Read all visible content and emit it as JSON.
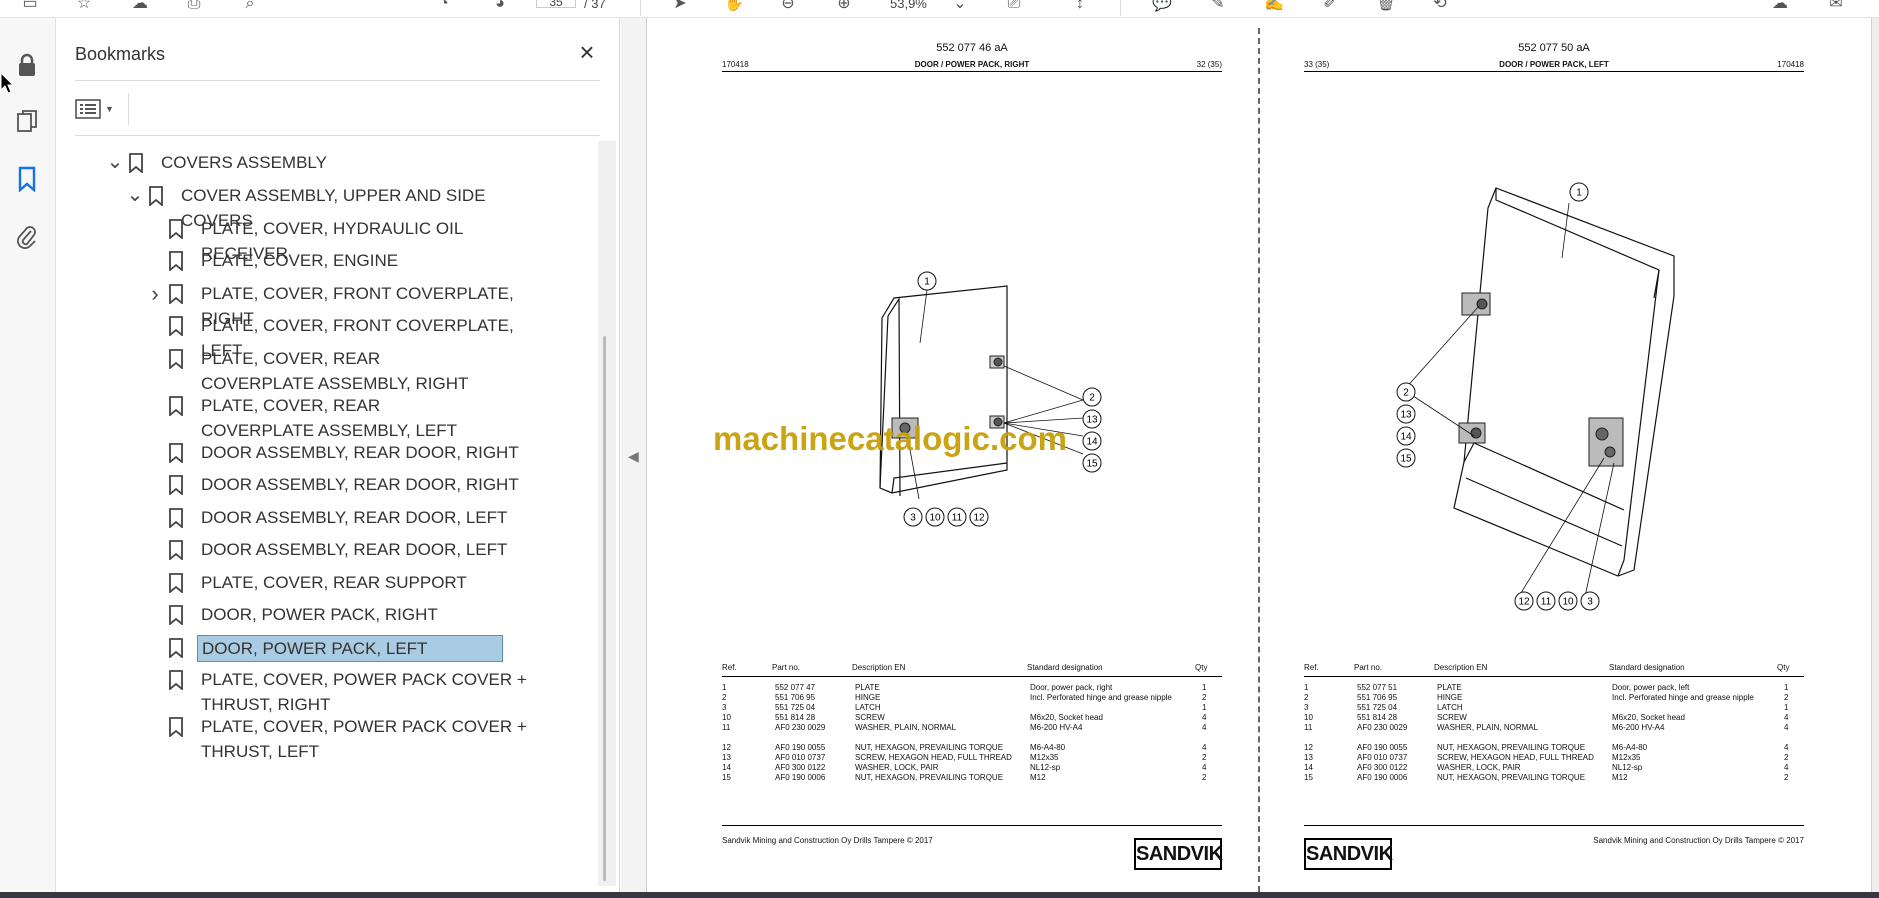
{
  "toolbar": {
    "page_current": "35",
    "page_total": "/ 37",
    "zoom": "53,9%"
  },
  "bookmarks_panel": {
    "title": "Bookmarks",
    "items": [
      {
        "label": "COVERS ASSEMBLY",
        "expanded": true
      },
      {
        "label": "COVER ASSEMBLY, UPPER AND SIDE COVERS",
        "expanded": true
      },
      {
        "label": "PLATE, COVER, HYDRAULIC OIL RECEIVER"
      },
      {
        "label": "PLATE, COVER, ENGINE"
      },
      {
        "label": "PLATE, COVER, FRONT COVERPLATE, RIGHT",
        "expanded": false
      },
      {
        "label": "PLATE, COVER, FRONT COVERPLATE, LEFT"
      },
      {
        "label": "PLATE, COVER, REAR COVERPLATE ASSEMBLY, RIGHT"
      },
      {
        "label": "PLATE, COVER, REAR COVERPLATE ASSEMBLY, LEFT"
      },
      {
        "label": "DOOR ASSEMBLY, REAR DOOR, RIGHT"
      },
      {
        "label": "DOOR ASSEMBLY, REAR DOOR, RIGHT"
      },
      {
        "label": "DOOR ASSEMBLY, REAR DOOR, LEFT"
      },
      {
        "label": "DOOR ASSEMBLY, REAR DOOR, LEFT"
      },
      {
        "label": "PLATE, COVER, REAR SUPPORT"
      },
      {
        "label": "DOOR, POWER PACK, RIGHT"
      },
      {
        "label": "DOOR, POWER PACK, LEFT",
        "selected": true
      },
      {
        "label": "PLATE, COVER, POWER PACK COVER + THRUST, RIGHT"
      },
      {
        "label": "PLATE, COVER, POWER PACK COVER + THRUST, LEFT"
      }
    ]
  },
  "watermark": "machinecatalogic.com",
  "pages": [
    {
      "doc_number": "552 077 46 aA",
      "left_code": "170418",
      "title": "DOOR / POWER PACK, RIGHT",
      "right_code": "32 (35)",
      "callouts": [
        "1",
        "2",
        "13",
        "14",
        "15",
        "3",
        "10",
        "11",
        "12"
      ],
      "table_header": {
        "ref": "Ref.",
        "part": "Part no.",
        "desc": "Description EN",
        "std": "Standard designation",
        "qty": "Qty"
      },
      "rows_a": [
        {
          "ref": "1",
          "part": "552 077 47",
          "desc": "PLATE",
          "std": "Door, power pack, right",
          "qty": "1"
        },
        {
          "ref": "2",
          "part": "551 706 95",
          "desc": "HINGE",
          "std": "Incl. Perforated hinge and grease nipple",
          "qty": "2"
        },
        {
          "ref": "3",
          "part": "551 725 04",
          "desc": "LATCH",
          "std": "",
          "qty": "1"
        },
        {
          "ref": "10",
          "part": "551 814 28",
          "desc": "SCREW",
          "std": "M6x20, Socket head",
          "qty": "4"
        },
        {
          "ref": "11",
          "part": "AF0 230 0029",
          "desc": "WASHER, PLAIN, NORMAL",
          "std": "M6-200 HV-A4",
          "qty": "4"
        }
      ],
      "rows_b": [
        {
          "ref": "12",
          "part": "AF0 190 0055",
          "desc": "NUT, HEXAGON, PREVAILING TORQUE",
          "std": "M6-A4-80",
          "qty": "4"
        },
        {
          "ref": "13",
          "part": "AF0 010 0737",
          "desc": "SCREW, HEXAGON HEAD, FULL THREAD",
          "std": "M12x35",
          "qty": "2"
        },
        {
          "ref": "14",
          "part": "AF0 300 0122",
          "desc": "WASHER, LOCK, PAIR",
          "std": "NL12-sp",
          "qty": "4"
        },
        {
          "ref": "15",
          "part": "AF0 190 0006",
          "desc": "NUT, HEXAGON, PREVAILING TORQUE",
          "std": "M12",
          "qty": "2"
        }
      ],
      "footer": "Sandvik Mining and Construction Oy Drills Tampere © 2017",
      "logo": "SANDVIK"
    },
    {
      "doc_number": "552 077 50 aA",
      "left_code": "33 (35)",
      "title": "DOOR / POWER PACK, LEFT",
      "right_code": "170418",
      "callouts": [
        "1",
        "2",
        "13",
        "14",
        "15",
        "12",
        "11",
        "10",
        "3"
      ],
      "table_header": {
        "ref": "Ref.",
        "part": "Part no.",
        "desc": "Description EN",
        "std": "Standard designation",
        "qty": "Qty"
      },
      "rows_a": [
        {
          "ref": "1",
          "part": "552 077 51",
          "desc": "PLATE",
          "std": "Door, power pack, left",
          "qty": "1"
        },
        {
          "ref": "2",
          "part": "551 706 95",
          "desc": "HINGE",
          "std": "Incl. Perforated hinge and grease nipple",
          "qty": "2"
        },
        {
          "ref": "3",
          "part": "551 725 04",
          "desc": "LATCH",
          "std": "",
          "qty": "1"
        },
        {
          "ref": "10",
          "part": "551 814 28",
          "desc": "SCREW",
          "std": "M6x20, Socket head",
          "qty": "4"
        },
        {
          "ref": "11",
          "part": "AF0 230 0029",
          "desc": "WASHER, PLAIN, NORMAL",
          "std": "M6-200 HV-A4",
          "qty": "4"
        }
      ],
      "rows_b": [
        {
          "ref": "12",
          "part": "AF0 190 0055",
          "desc": "NUT, HEXAGON, PREVAILING TORQUE",
          "std": "M6-A4-80",
          "qty": "4"
        },
        {
          "ref": "13",
          "part": "AF0 010 0737",
          "desc": "SCREW, HEXAGON HEAD, FULL THREAD",
          "std": "M12x35",
          "qty": "2"
        },
        {
          "ref": "14",
          "part": "AF0 300 0122",
          "desc": "WASHER, LOCK, PAIR",
          "std": "NL12-sp",
          "qty": "4"
        },
        {
          "ref": "15",
          "part": "AF0 190 0006",
          "desc": "NUT, HEXAGON, PREVAILING TORQUE",
          "std": "M12",
          "qty": "2"
        }
      ],
      "footer": "Sandvik Mining and Construction Oy Drills Tampere © 2017",
      "logo": "SANDVIK"
    }
  ]
}
